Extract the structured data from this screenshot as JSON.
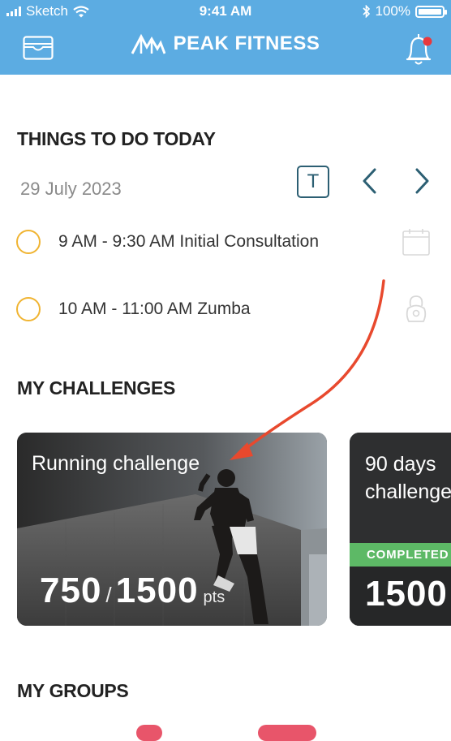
{
  "status_bar": {
    "carrier": "Sketch",
    "time": "9:41 AM",
    "battery": "100%"
  },
  "header": {
    "brand": "PEAK FITNESS",
    "icons": [
      "wallet-icon",
      "peak-logo-icon",
      "bell-icon"
    ],
    "accent": "#5cace2"
  },
  "today": {
    "title": "THINGS TO DO TODAY",
    "date": "29 July 2023",
    "today_button": "T",
    "items": [
      {
        "label": "9 AM - 9:30 AM Initial Consultation",
        "icon": "calendar-icon"
      },
      {
        "label": "10 AM - 11:00 AM Zumba",
        "icon": "kettlebell-icon"
      }
    ]
  },
  "challenges": {
    "title": "MY CHALLENGES",
    "cards": [
      {
        "title": "Running challenge",
        "progress": "750",
        "target": "1500",
        "unit": "pts"
      },
      {
        "title": "90 days challenge",
        "status": "COMPLETED",
        "progress": "1500"
      }
    ]
  },
  "groups": {
    "title": "MY GROUPS"
  },
  "colors": {
    "todo_circle": "#f0b432",
    "completed": "#5db966",
    "annotation_arrow": "#e8492e",
    "today_button": "#2c5f73"
  }
}
